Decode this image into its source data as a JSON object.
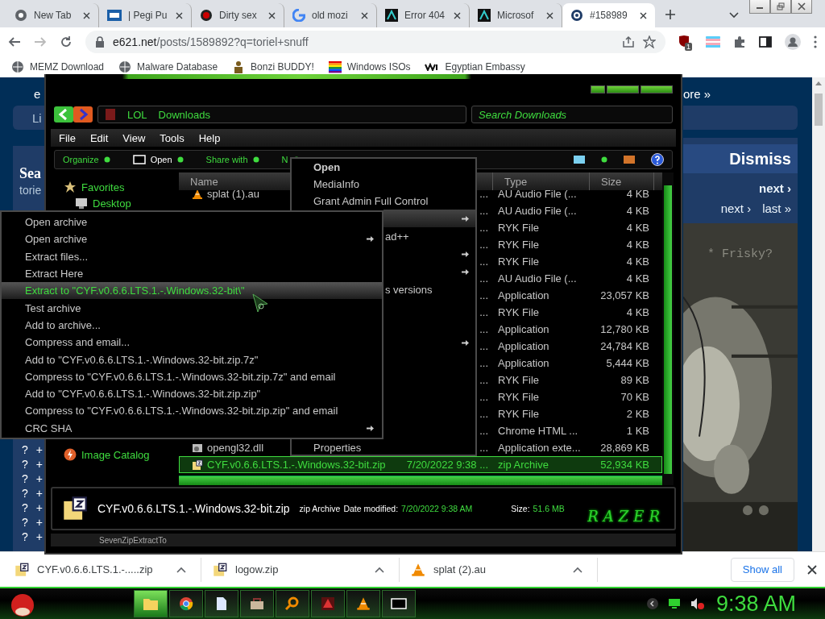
{
  "browser": {
    "tabs": [
      {
        "title": "New Tab",
        "kind": "chrome",
        "selected": false
      },
      {
        "title": "| Pegi Pu",
        "kind": "badge",
        "selected": false
      },
      {
        "title": "Dirty sex",
        "kind": "dot",
        "selected": false
      },
      {
        "title": "old mozi",
        "kind": "g",
        "selected": false
      },
      {
        "title": "Error 404",
        "kind": "glyph",
        "selected": false
      },
      {
        "title": "Microsof",
        "kind": "glyph",
        "selected": false
      },
      {
        "title": "#158989",
        "kind": "e",
        "selected": true
      }
    ],
    "url_host": "e621.net",
    "url_path": "/posts/1589892?q=toriel+snuff",
    "extension_badge": "1",
    "bookmarks": [
      {
        "label": "MEMZ Download",
        "kind": "globe"
      },
      {
        "label": "Malware Database",
        "kind": "globe"
      },
      {
        "label": "Bonzi BUDDY!",
        "kind": "figure"
      },
      {
        "label": "Windows ISOs",
        "kind": "flag"
      },
      {
        "label": "Egyptian Embassy",
        "kind": "wix"
      }
    ]
  },
  "page": {
    "left": {
      "logo": "e",
      "button": "Li",
      "heading": "Sea",
      "subtext": "torie",
      "rows": [
        {
          "q": "?",
          "plus": "+"
        },
        {
          "q": "?",
          "plus": "+"
        },
        {
          "q": "?",
          "plus": "+"
        },
        {
          "q": "?",
          "plus": "+"
        },
        {
          "q": "?",
          "plus": "+"
        },
        {
          "q": "?",
          "plus": "+"
        },
        {
          "q": "?",
          "plus": "+"
        }
      ]
    },
    "right": {
      "more": "ore »",
      "dismiss": "Dismiss",
      "next_top": "next ›",
      "next": "next ›",
      "last": "last »",
      "caption": "* Frisky?"
    }
  },
  "explorer": {
    "address": [
      "LOL",
      "Downloads"
    ],
    "search": {
      "placeholder": "Search Downloads"
    },
    "menu": [
      "File",
      "Edit",
      "View",
      "Tools",
      "Help"
    ],
    "commands": [
      "Organize",
      "Open",
      "Share with",
      "N"
    ],
    "nav": [
      {
        "label": "Favorites",
        "kind": "star",
        "children": [
          {
            "label": "Desktop",
            "kind": "desktop"
          }
        ]
      },
      {
        "label": "Image Catalog",
        "kind": "bolt"
      }
    ],
    "columns": [
      "Name",
      "Type",
      "Size"
    ],
    "files": [
      {
        "name": "splat (1).au",
        "kind": "cone",
        "date": "...",
        "type": "AU Audio File (...",
        "size": "4 KB",
        "selected": false
      },
      {
        "date": "...",
        "type": "AU Audio File (...",
        "size": "4 KB",
        "selected": false
      },
      {
        "date": "...",
        "type": "RYK File",
        "size": "4 KB",
        "selected": false
      },
      {
        "date": "...",
        "type": "RYK File",
        "size": "4 KB",
        "selected": false
      },
      {
        "date": "...",
        "type": "RYK File",
        "size": "4 KB",
        "selected": false
      },
      {
        "date": "...",
        "type": "AU Audio File (...",
        "size": "4 KB",
        "selected": false
      },
      {
        "date": "...",
        "type": "Application",
        "size": "23,057 KB",
        "selected": false
      },
      {
        "date": "...",
        "type": "RYK File",
        "size": "4 KB",
        "selected": false
      },
      {
        "date": "...",
        "type": "Application",
        "size": "12,780 KB",
        "selected": false
      },
      {
        "date": "...",
        "type": "Application",
        "size": "24,784 KB",
        "selected": false
      },
      {
        "date": "...",
        "type": "Application",
        "size": "5,444 KB",
        "selected": false
      },
      {
        "date": "...",
        "type": "RYK File",
        "size": "89 KB",
        "selected": false
      },
      {
        "date": "...",
        "type": "RYK File",
        "size": "70 KB",
        "selected": false
      },
      {
        "date": "...",
        "type": "RYK File",
        "size": "2 KB",
        "selected": false
      },
      {
        "date": "...",
        "type": "Chrome HTML ...",
        "size": "1 KB",
        "selected": false
      },
      {
        "name": "opengl32.dll",
        "kind": "dll",
        "date": "...",
        "type": "Application exte...",
        "size": "28,869 KB",
        "selected": false
      },
      {
        "name": "CYF.v0.6.6.LTS.1.-.Windows.32-bit.zip",
        "kind": "zip",
        "date": "7/20/2022 9:38 ...",
        "type": "zip Archive",
        "size": "52,934 KB",
        "selected": true
      }
    ],
    "details": {
      "name": "CYF.v0.6.6.LTS.1.-.Windows.32-bit.zip",
      "type": "zip Archive",
      "date_label": "Date modified:",
      "date": "7/20/2022 9:38 AM",
      "size_label": "Size:",
      "size": "51.6 MB",
      "logo": "RAZER"
    },
    "status": "SevenZipExtractTo"
  },
  "shell_menu": {
    "items": [
      {
        "label": "Open",
        "bold": true,
        "submenu": false,
        "selected": false
      },
      {
        "label": "MediaInfo",
        "bold": false,
        "submenu": false,
        "selected": false
      },
      {
        "label": "Grant Admin Full Control",
        "bold": false,
        "submenu": false,
        "selected": false
      },
      {
        "submenu": true,
        "selected": true
      },
      {
        "label": "ad++",
        "bold": false,
        "submenu": false,
        "selected": false
      },
      {
        "submenu": true,
        "selected": false
      },
      {
        "submenu": true,
        "selected": false
      },
      {
        "label": "s versions",
        "bold": false,
        "submenu": false,
        "selected": false
      },
      {
        "submenu": false,
        "selected": false
      },
      {
        "submenu": false,
        "selected": false
      },
      {
        "submenu": true,
        "selected": false
      },
      {
        "submenu": false,
        "selected": false
      },
      {
        "submenu": false,
        "selected": false
      },
      {
        "submenu": false,
        "selected": false
      },
      {
        "submenu": false,
        "selected": false
      },
      {
        "submenu": false,
        "selected": false
      },
      {
        "label": "Properties",
        "bold": false,
        "submenu": false,
        "selected": false
      }
    ]
  },
  "archive_menu": {
    "items": [
      {
        "label": "Open archive",
        "submenu": false,
        "selected": false
      },
      {
        "label": "Open archive",
        "submenu": true,
        "selected": false
      },
      {
        "label": "Extract files...",
        "submenu": false,
        "selected": false
      },
      {
        "label": "Extract Here",
        "submenu": false,
        "selected": false
      },
      {
        "label": "Extract to \"CYF.v0.6.6.LTS.1.-.Windows.32-bit\\\"",
        "submenu": false,
        "selected": true
      },
      {
        "label": "Test archive",
        "submenu": false,
        "selected": false
      },
      {
        "label": "Add to archive...",
        "submenu": false,
        "selected": false
      },
      {
        "label": "Compress and email...",
        "submenu": false,
        "selected": false
      },
      {
        "label": "Add to \"CYF.v0.6.6.LTS.1.-.Windows.32-bit.zip.7z\"",
        "submenu": false,
        "selected": false
      },
      {
        "label": "Compress to \"CYF.v0.6.6.LTS.1.-.Windows.32-bit.zip.7z\" and email",
        "submenu": false,
        "selected": false
      },
      {
        "label": "Add to \"CYF.v0.6.6.LTS.1.-.Windows.32-bit.zip.zip\"",
        "submenu": false,
        "selected": false
      },
      {
        "label": "Compress to \"CYF.v0.6.6.LTS.1.-.Windows.32-bit.zip.zip\" and email",
        "submenu": false,
        "selected": false
      },
      {
        "label": "CRC SHA",
        "submenu": true,
        "selected": false
      }
    ]
  },
  "downloads": {
    "items": [
      {
        "name": "CYF.v0.6.6.LTS.1.-.....zip",
        "kind": "zip"
      },
      {
        "name": "logow.zip",
        "kind": "zip"
      },
      {
        "name": "splat (2).au",
        "kind": "cone"
      }
    ],
    "show_all": "Show all"
  },
  "taskbar": {
    "apps": [
      {
        "kind": "folder",
        "selected": true
      },
      {
        "kind": "chrome",
        "selected": false
      },
      {
        "kind": "doc",
        "selected": false
      },
      {
        "kind": "tool",
        "selected": false
      },
      {
        "kind": "search",
        "selected": false
      },
      {
        "kind": "dragon",
        "selected": false
      },
      {
        "kind": "cone",
        "selected": false
      },
      {
        "kind": "box",
        "selected": false
      }
    ],
    "clock": "9:38 AM"
  }
}
